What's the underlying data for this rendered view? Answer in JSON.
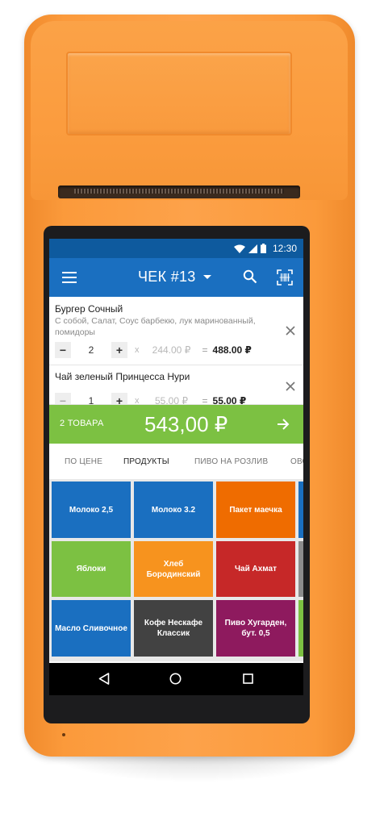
{
  "status_bar": {
    "time": "12:30",
    "icons": [
      "wifi-icon",
      "signal-icon",
      "battery-icon"
    ]
  },
  "app_bar": {
    "title": "ЧЕК #13",
    "icons": [
      "menu-icon",
      "caret-down-icon",
      "search-icon",
      "barcode-scan-icon"
    ]
  },
  "receipt": {
    "items": [
      {
        "name": "Бургер Сочный",
        "description": "С собой, Салат, Соус барбекю, лук маринованный, помидоры",
        "qty": "2",
        "mult": "x",
        "price": "244.00 ₽",
        "eq": "=",
        "total": "488.00 ₽",
        "minus": "−",
        "plus": "+"
      },
      {
        "name": "Чай зеленый Принцесса Нури",
        "qty": "1",
        "mult": "x",
        "price": "55.00 ₽",
        "eq": "=",
        "total": "55.00 ₽",
        "minus": "−",
        "plus": "+"
      }
    ]
  },
  "pay_bar": {
    "count": "2 ТОВАРА",
    "total": "543,00 ₽",
    "color": "#7cc142"
  },
  "tabs": [
    {
      "label": "ПО ЦЕНЕ",
      "active": false
    },
    {
      "label": "ПРОДУКТЫ",
      "active": true
    },
    {
      "label": "ПИВО НА РОЗЛИВ",
      "active": false
    },
    {
      "label": "ОВО",
      "active": false
    }
  ],
  "tiles": [
    {
      "label": "Молоко 2,5",
      "color": "#1a6fc0"
    },
    {
      "label": "Молоко 3.2",
      "color": "#1a6fc0"
    },
    {
      "label": "Пакет маечка",
      "color": "#ef6c00"
    },
    {
      "label": "Яблоки",
      "color": "#7cc142"
    },
    {
      "label": "Хлеб Бородинский",
      "color": "#f7931e"
    },
    {
      "label": "Чай Ахмат",
      "color": "#c62828"
    },
    {
      "label": "Масло Сливочное",
      "color": "#1a6fc0"
    },
    {
      "label": "Кофе Нескафе Классик",
      "color": "#424242"
    },
    {
      "label": "Пиво Хугарден, бут. 0,5",
      "color": "#8e1a5e"
    }
  ],
  "nav_bar": {
    "icons": [
      "back-icon",
      "home-icon",
      "recent-apps-icon"
    ]
  },
  "colors": {
    "primary": "#1a6fc0",
    "status_bar": "#0e5a9e",
    "accent_orange": "#f07a1e",
    "device_orange": "#fb9c3e"
  }
}
